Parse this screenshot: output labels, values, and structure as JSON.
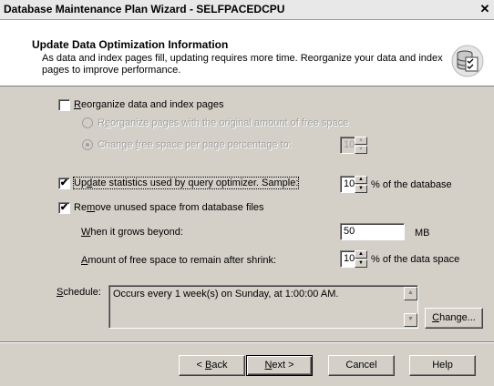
{
  "window": {
    "title": "Database Maintenance Plan Wizard - SELFPACEDCPU",
    "close_glyph": "✕"
  },
  "header": {
    "title": "Update Data Optimization Information",
    "description": "As data and index pages fill, updating requires more time. Reorganize your data and index pages to improve performance.",
    "icon": "database-checklist-icon"
  },
  "options": {
    "reorganize": {
      "checked": false,
      "label_pre": "",
      "label_key": "R",
      "label_post": "eorganize data and index pages"
    },
    "reorg_original": {
      "label_pre": "R",
      "label_key": "e",
      "label_post": "organize pages with the original amount of free space",
      "enabled": false
    },
    "reorg_change": {
      "label_pre": "Change ",
      "label_key": "f",
      "label_post": "ree space per page percentage to:",
      "value": "10",
      "enabled": false,
      "selected": true
    },
    "update_stats": {
      "checked": true,
      "label_pre": "Up",
      "label_key": "d",
      "label_post": "ate statistics used by query optimizer. Sample:",
      "value": "10",
      "suffix": "% of the database"
    },
    "remove_unused": {
      "checked": true,
      "label_pre": "Re",
      "label_key": "m",
      "label_post": "ove unused space from database files"
    },
    "grows_beyond": {
      "label_pre": "",
      "label_key": "W",
      "label_post": "hen it grows beyond:",
      "value": "50",
      "unit": "MB"
    },
    "free_space": {
      "label_pre": "",
      "label_key": "A",
      "label_post": "mount of free space to remain after shrink:",
      "value": "10",
      "suffix": "% of the data space"
    }
  },
  "schedule": {
    "label_pre": "",
    "label_key": "S",
    "label_post": "chedule:",
    "text": "Occurs every 1 week(s) on Sunday, at 1:00:00 AM.",
    "change_pre": "",
    "change_key": "C",
    "change_post": "hange..."
  },
  "buttons": {
    "back_pre": "< ",
    "back_key": "B",
    "back_post": "ack",
    "next_pre": "",
    "next_key": "N",
    "next_post": "ext >",
    "cancel": "Cancel",
    "help": "Help"
  },
  "glyphs": {
    "check": "✔",
    "arrow_up": "▲",
    "arrow_down": "▼"
  }
}
